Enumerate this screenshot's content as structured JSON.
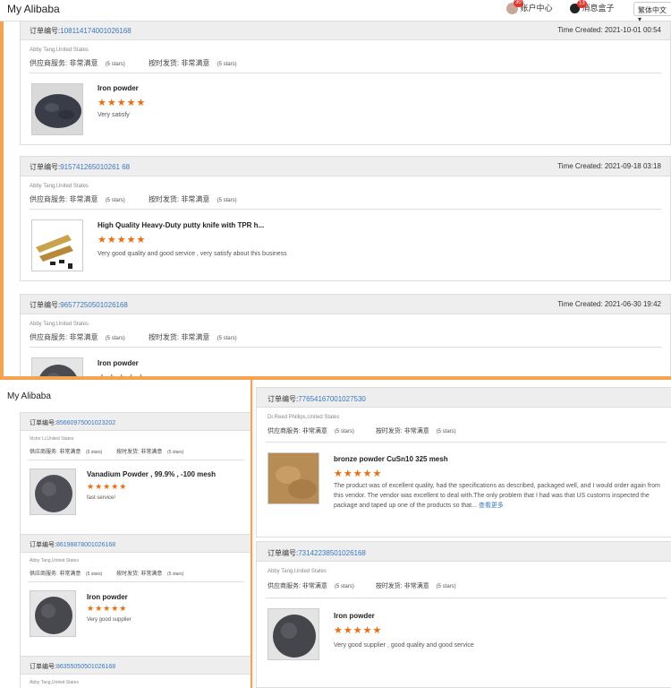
{
  "top_panel": {
    "title": "My Alibaba",
    "account": {
      "badge": "30",
      "label": "账户中心"
    },
    "messages": {
      "badge": "13",
      "label": "消息盒子"
    },
    "language": "繁体中文 ▾",
    "cards": [
      {
        "order_label": "订单编号:",
        "order_no": "108114174001026168",
        "time": "Time Created: 2021-10-01 00:54",
        "buyer": "Abby Tang,United States",
        "supplier_service": "供应商服务: 非常满意",
        "supplier_stars": "(5 stars)",
        "ontime": "按时发货: 非常满意",
        "ontime_stars": "(5 stars)",
        "product": "Iron powder",
        "stars": "★★★★★",
        "review": "Very satisfy"
      },
      {
        "order_label": "订单编号:",
        "order_no": "915741265010261 68",
        "time": "Time Created: 2021-09-18 03:18",
        "buyer": "Abby Tang,United States",
        "supplier_service": "供应商服务: 非常满意",
        "supplier_stars": "(5 stars)",
        "ontime": "按时发货: 非常满意",
        "ontime_stars": "(5 stars)",
        "product": "High Quality Heavy-Duty putty knife with TPR h...",
        "stars": "★★★★★",
        "review": "Very good quality and good service , very satisfy about this business"
      },
      {
        "order_label": "订单编号:",
        "order_no": "96577250501026168",
        "time": "Time Created: 2021-06-30 19:42",
        "buyer": "Abby Tang,United States",
        "supplier_service": "供应商服务: 非常满意",
        "supplier_stars": "(5 stars)",
        "ontime": "按时发货: 非常满意",
        "ontime_stars": "(5 stars)",
        "product": "Iron powder",
        "stars": "★★★★★",
        "review": ""
      }
    ]
  },
  "left_panel": {
    "title": "My Alibaba",
    "cards": [
      {
        "order_label": "订单编号:",
        "order_no": "85660975001023202",
        "buyer": "Victor Li,United States",
        "supplier_service": "供应商服务: 非常满意",
        "supplier_stars": "(5 stars)",
        "ontime": "按时发货: 非常满意",
        "ontime_stars": "(5 stars)",
        "product": "Vanadium Powder , 99.9% , -100 mesh",
        "stars": "★★★★★",
        "review": "fast service!"
      },
      {
        "order_label": "订单编号:",
        "order_no": "86198878001026168",
        "buyer": "Abby Tang,United States",
        "supplier_service": "供应商服务: 非常满意",
        "supplier_stars": "(5 stars)",
        "ontime": "按时发货: 非常满意",
        "ontime_stars": "(5 stars)",
        "product": "Iron powder",
        "stars": "★★★★★",
        "review": "Very good supplier"
      },
      {
        "order_label": "订单编号:",
        "order_no": "86355050501026168",
        "buyer": "Abby Tang,United States"
      }
    ]
  },
  "right_panel": {
    "cards": [
      {
        "order_label": "订单编号:",
        "order_no": "77654167001027530",
        "buyer": "Dr.Reed Phillips,United States",
        "supplier_service": "供应商服务: 非常满意",
        "supplier_stars": "(5 stars)",
        "ontime": "按时发货: 非常满意",
        "ontime_stars": "(5 stars)",
        "product": "bronze powder CuSn10 325 mesh",
        "stars": "★★★★★",
        "review": "The product was of excellent quality, had the specifications as described, packaged well, and I would order again from this vendor. The vendor was excellent to deal with.The only problem that I had was that US customs inspected the package and taped up one of the products so that...",
        "more": "查看更多"
      },
      {
        "order_label": "订单编号:",
        "order_no": "73142238501026168",
        "buyer": "Abby Tang,United States",
        "supplier_service": "供应商服务: 非常满意",
        "supplier_stars": "(5 stars)",
        "ontime": "按时发货: 非常满意",
        "ontime_stars": "(5 stars)",
        "product": "Iron powder",
        "stars": "★★★★★",
        "review": "Very good supplier , good quality and good service"
      }
    ]
  },
  "colors": {
    "accent_orange": "#f4a44e",
    "star": "#f26b0a",
    "link": "#3a78c3"
  }
}
